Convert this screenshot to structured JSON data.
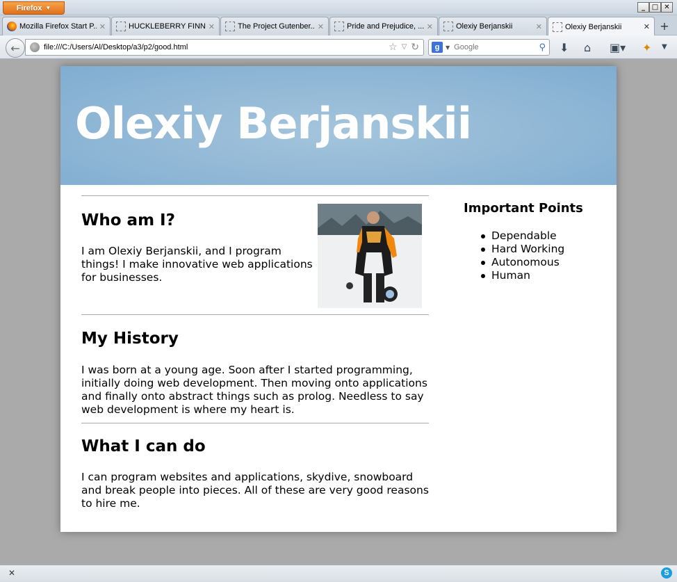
{
  "browser": {
    "menu_button": "Firefox",
    "window_controls": {
      "minimize": "_",
      "maximize": "□",
      "close": "✕"
    },
    "tabs": [
      {
        "label": "Mozilla Firefox Start P...",
        "icon": "firefox-icon",
        "active": false
      },
      {
        "label": "HUCKLEBERRY FINN, ...",
        "icon": "blank-page-icon",
        "active": false
      },
      {
        "label": "The Project Gutenber...",
        "icon": "blank-page-icon",
        "active": false
      },
      {
        "label": "Pride and Prejudice, ...",
        "icon": "blank-page-icon",
        "active": false
      },
      {
        "label": "Olexiy Berjanskii",
        "icon": "blank-page-icon",
        "active": false
      },
      {
        "label": "Olexiy Berjanskii",
        "icon": "blank-page-icon",
        "active": true
      }
    ],
    "tab_close_glyph": "✕",
    "new_tab_glyph": "+",
    "url": "file:///C:/Users/Al/Desktop/a3/p2/good.html",
    "search_engine": "g",
    "search_placeholder": "Google"
  },
  "page": {
    "header_title": "Olexiy Berjanskii",
    "header_color": "#8fb6d5",
    "sections": [
      {
        "heading": "Who am I?",
        "body": "I am Olexiy Berjanskii, and I program things! I make innovative web applications for businesses."
      },
      {
        "heading": "My History",
        "body": "I was born at a young age. Soon after I started programming, initially doing web development. Then moving onto applications and finally onto abstract things such as prolog. Needless to say web development is where my heart is."
      },
      {
        "heading": "What I can do",
        "body": "I can program websites and applications, skydive, snowboard and break people into pieces. All of these are very good reasons to hire me."
      }
    ],
    "aside": {
      "heading": "Important Points",
      "items": [
        "Dependable",
        "Hard Working",
        "Autonomous",
        "Human"
      ]
    }
  },
  "statusbar": {
    "close_glyph": "✕",
    "skype_glyph": "S"
  }
}
